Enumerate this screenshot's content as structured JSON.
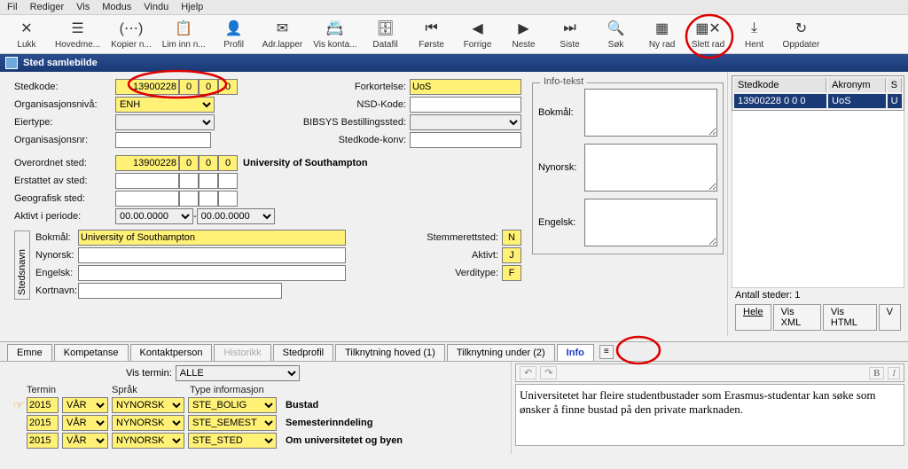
{
  "menubar": [
    "Fil",
    "Rediger",
    "Vis",
    "Modus",
    "Vindu",
    "Hjelp"
  ],
  "toolbar": [
    {
      "label": "Lukk",
      "glyph": "✕"
    },
    {
      "label": "Hovedme...",
      "glyph": "☰"
    },
    {
      "label": "Kopier n...",
      "glyph": "(⋯)"
    },
    {
      "label": "Lim inn n...",
      "glyph": "📋"
    },
    {
      "label": "Profil",
      "glyph": "👤"
    },
    {
      "label": "Adr.lapper",
      "glyph": "✉"
    },
    {
      "label": "Vis konta...",
      "glyph": "📇"
    },
    {
      "label": "Datafil",
      "glyph": "🗄"
    },
    {
      "label": "Første",
      "glyph": "⏮"
    },
    {
      "label": "Forrige",
      "glyph": "◀"
    },
    {
      "label": "Neste",
      "glyph": "▶"
    },
    {
      "label": "Siste",
      "glyph": "⏭"
    },
    {
      "label": "Søk",
      "glyph": "🔍"
    },
    {
      "label": "Ny rad",
      "glyph": "▦"
    },
    {
      "label": "Slett rad",
      "glyph": "▦✕"
    },
    {
      "label": "Hent",
      "glyph": "⤓"
    },
    {
      "label": "Oppdater",
      "glyph": "↻"
    }
  ],
  "window_title": "Sted samlebilde",
  "labels": {
    "stedkode": "Stedkode:",
    "orgniva": "Organisasjonsnivå:",
    "eiertype": "Eiertype:",
    "orgnr": "Organisasjonsnr:",
    "overordnet": "Overordnet sted:",
    "erstattet": "Erstattet av sted:",
    "geografisk": "Geografisk sted:",
    "aktivperiode": "Aktivt i periode:",
    "bokmal": "Bokmål:",
    "nynorsk": "Nynorsk:",
    "engelsk": "Engelsk:",
    "kortnavn": "Kortnavn:",
    "forkortelse": "Forkortelse:",
    "nsd": "NSD-Kode:",
    "bibsys": "BIBSYS Bestillingssted:",
    "stedkonv": "Stedkode-konv:",
    "stemmeret": "Stemmerettsted:",
    "aktivt": "Aktivt:",
    "verditype": "Verditype:",
    "infotekst": "Info-tekst",
    "stedsnavn": "Stedsnavn"
  },
  "values": {
    "stedkode_main": "13900228",
    "stedkode_p1": "0",
    "stedkode_p2": "0",
    "stedkode_p3": "0",
    "orgniva": "ENH",
    "overordnet_main": "13900228",
    "overordnet_p1": "0",
    "overordnet_p2": "0",
    "overordnet_p3": "0",
    "overordnet_name": "University of Southampton",
    "periode_from": "00.00.0000",
    "periode_to": "00.00.0000",
    "navn_bokmal": "University of Southampton",
    "forkortelse": "UoS",
    "stemmeret": "N",
    "aktivt": "J",
    "verditype": "F"
  },
  "right_table": {
    "headers": [
      "Stedkode",
      "Akronym",
      "S"
    ],
    "row": {
      "code": "13900228 0   0   0",
      "akr": "UoS",
      "s": "U"
    }
  },
  "right_footer": {
    "count_label": "Antall steder: 1",
    "buttons": [
      "Hele",
      "Vis XML",
      "Vis HTML",
      "V"
    ]
  },
  "tabs": {
    "items": [
      "Emne",
      "Kompetanse",
      "Kontaktperson",
      "Historikk",
      "Stedprofil",
      "Tilknytning hoved (1)",
      "Tilknytning under (2)",
      "Info"
    ],
    "disabled": 3,
    "active": 7
  },
  "bottom": {
    "vis_termin_label": "Vis termin:",
    "vis_termin": "ALLE",
    "headers": [
      "Termin",
      "Språk",
      "Type informasjon"
    ],
    "rows": [
      {
        "y": "2015",
        "s": "VÅR",
        "l": "NYNORSK",
        "t": "STE_BOLIG",
        "d": "Bustad",
        "ptr": true
      },
      {
        "y": "2015",
        "s": "VÅR",
        "l": "NYNORSK",
        "t": "STE_SEMEST",
        "d": "Semesterinndeling",
        "ptr": false
      },
      {
        "y": "2015",
        "s": "VÅR",
        "l": "NYNORSK",
        "t": "STE_STED",
        "d": "Om universitetet og byen",
        "ptr": false
      }
    ],
    "rtf": "Universitetet har fleire studentbustader som Erasmus-studentar kan søke som ønsker å finne bustad på den private marknaden."
  }
}
